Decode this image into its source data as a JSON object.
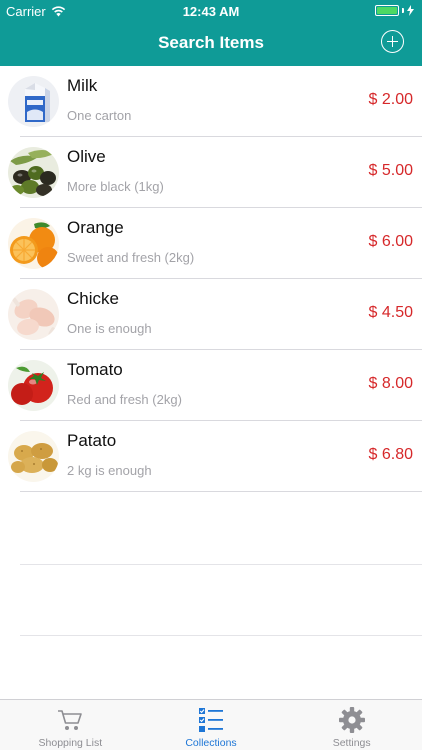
{
  "status_bar": {
    "carrier": "Carrier",
    "time": "12:43 AM"
  },
  "nav": {
    "title": "Search Items",
    "add_icon": "plus-circle-icon"
  },
  "items": [
    {
      "name": "Milk",
      "description": "One carton",
      "price": "$ 2.00",
      "image": "milk-carton"
    },
    {
      "name": "Olive",
      "description": "More black (1kg)",
      "price": "$ 5.00",
      "image": "olives"
    },
    {
      "name": "Orange",
      "description": "Sweet and fresh (2kg)",
      "price": "$ 6.00",
      "image": "oranges"
    },
    {
      "name": "Chicke",
      "description": "One is enough",
      "price": "$ 4.50",
      "image": "chicken-legs"
    },
    {
      "name": "Tomato",
      "description": "Red and fresh (2kg)",
      "price": "$ 8.00",
      "image": "tomatoes"
    },
    {
      "name": "Patato",
      "description": "2 kg is enough",
      "price": "$ 6.80",
      "image": "potatoes"
    }
  ],
  "tabs": [
    {
      "label": "Shopping List",
      "icon": "cart-icon",
      "active": false
    },
    {
      "label": "Collections",
      "icon": "checklist-icon",
      "active": true
    },
    {
      "label": "Settings",
      "icon": "gear-icon",
      "active": false
    }
  ],
  "colors": {
    "nav": "#0f9b97",
    "price": "#d6282a",
    "active_tab": "#1e76d6",
    "battery": "#4cd964"
  }
}
